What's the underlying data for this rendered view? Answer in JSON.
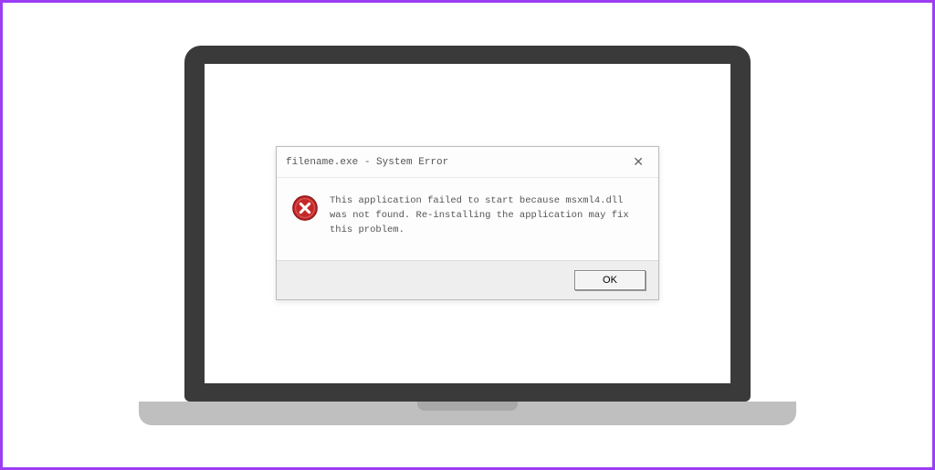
{
  "dialog": {
    "title": "filename.exe - System Error",
    "message": "This application failed to start because msxml4.dll was not found. Re-installing the application may fix this problem.",
    "ok_label": "OK"
  }
}
